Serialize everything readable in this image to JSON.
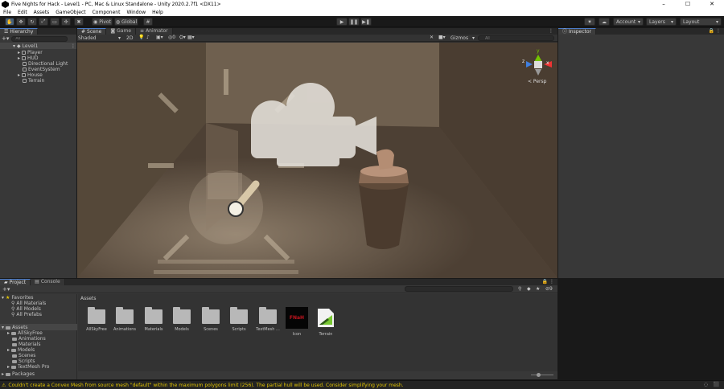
{
  "window": {
    "title": "Five Nights for Hack - Level1 - PC, Mac & Linux Standalone - Unity 2020.2.7f1 <DX11>",
    "minimize": "–",
    "maximize": "☐",
    "close": "✕"
  },
  "menu": [
    "File",
    "Edit",
    "Assets",
    "GameObject",
    "Component",
    "Window",
    "Help"
  ],
  "toolbar": {
    "pivot": "Pivot",
    "global": "Global",
    "account": "Account",
    "layers": "Layers",
    "layout": "Layout"
  },
  "hierarchy": {
    "tab": "Hierarchy",
    "search_placeholder": "All",
    "scene": "Level1",
    "items": [
      "Player",
      "HUD",
      "Directional Light",
      "EventSystem",
      "House",
      "Terrain"
    ]
  },
  "scene_view": {
    "tabs": [
      "Scene",
      "Game",
      "Animator"
    ],
    "shading": "Shaded",
    "mode_2d": "2D",
    "gizmos": "Gizmos",
    "search_placeholder": "All",
    "gizmo_axes": {
      "y": "y",
      "x": "x",
      "z": "z"
    },
    "projection": "< Persp"
  },
  "inspector": {
    "tab": "Inspector"
  },
  "project": {
    "tabs": [
      "Project",
      "Console"
    ],
    "favorites": {
      "label": "Favorites",
      "items": [
        "All Materials",
        "All Models",
        "All Prefabs"
      ]
    },
    "assets_root": {
      "label": "Assets",
      "items": [
        "AllSkyFree",
        "Animations",
        "Materials",
        "Models",
        "Scenes",
        "Scripts",
        "TextMesh Pro"
      ]
    },
    "packages": "Packages",
    "breadcrumb": "Assets",
    "assets": [
      "AllSkyFree",
      "Animations",
      "Materials",
      "Models",
      "Scenes",
      "Scripts",
      "TextMesh ...",
      "Icon",
      "Terrain"
    ],
    "icon_thumb_text": "FNaH",
    "hidden_count": "9",
    "slider_value": 0.35
  },
  "status": {
    "message": "Couldn't create a Convex Mesh from source mesh \"default\" within the maximum polygons limit (256). The partial hull will be used. Consider simplifying your mesh."
  },
  "colors": {
    "accent": "#4c7cc8",
    "warning": "#e4c600",
    "scene_wall": "#6b5a4a"
  }
}
